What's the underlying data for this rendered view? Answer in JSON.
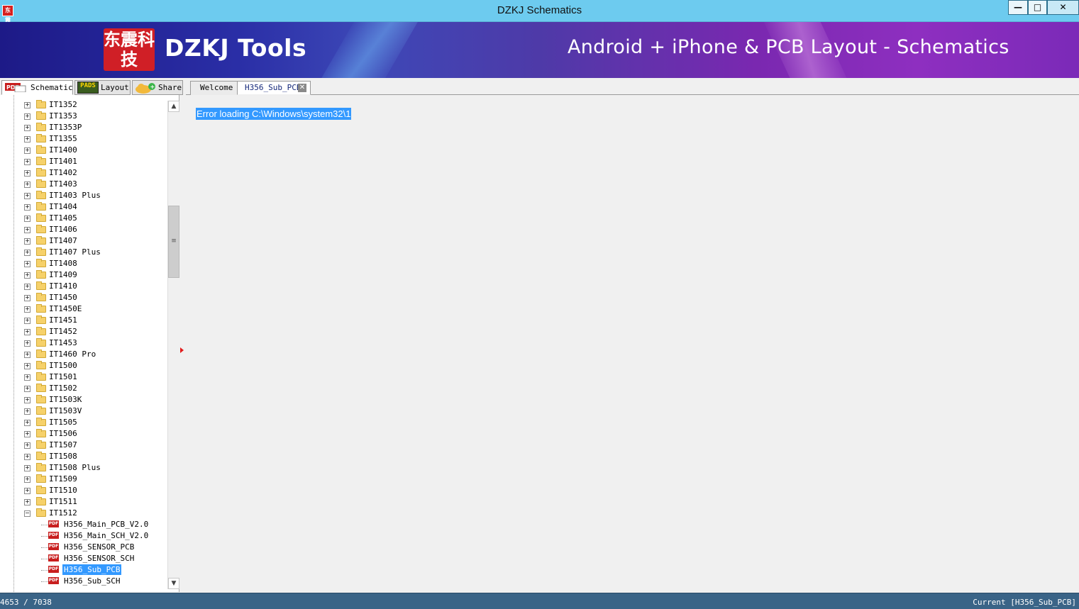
{
  "window": {
    "title": "DZKJ Schematics",
    "app_icon_text": "东震",
    "minimize": "—",
    "maximize": "□",
    "close": "✕"
  },
  "banner": {
    "logo_text": "东震科技",
    "brand": "DZKJ Tools",
    "tagline": "Android + iPhone & PCB Layout - Schematics"
  },
  "left_tabs": [
    {
      "label": "Schematic",
      "icon": "pdf-icon",
      "active": true
    },
    {
      "label": "Layout",
      "icon": "pads-icon",
      "icon_text": "PADS",
      "active": false
    },
    {
      "label": "Share",
      "icon": "cloud-share-icon",
      "active": false
    }
  ],
  "doc_tabs": [
    {
      "label": "Welcome",
      "active": false
    },
    {
      "label": "H356_Sub_PCB",
      "active": true,
      "close": "✕"
    }
  ],
  "tree": {
    "folders": [
      "IT1352",
      "IT1353",
      "IT1353P",
      "IT1355",
      "IT1400",
      "IT1401",
      "IT1402",
      "IT1403",
      "IT1403 Plus",
      "IT1404",
      "IT1405",
      "IT1406",
      "IT1407",
      "IT1407 Plus",
      "IT1408",
      "IT1409",
      "IT1410",
      "IT1450",
      "IT1450E",
      "IT1451",
      "IT1452",
      "IT1453",
      "IT1460 Pro",
      "IT1500",
      "IT1501",
      "IT1502",
      "IT1503K",
      "IT1503V",
      "IT1505",
      "IT1506",
      "IT1507",
      "IT1508",
      "IT1508 Plus",
      "IT1509",
      "IT1510",
      "IT1511",
      "IT1512"
    ],
    "expanded_folder": "IT1512",
    "files": [
      "H356_Main_PCB_V2.0",
      "H356_Main_SCH_V2.0",
      "H356_SENSOR_PCB",
      "H356_SENSOR_SCH",
      "H356_Sub_PCB",
      "H356_Sub_SCH"
    ],
    "selected_file": "H356_Sub_PCB",
    "pdf_icon_text": "PDF",
    "expand_symbol": "+",
    "collapse_symbol": "−"
  },
  "scrollbar": {
    "up": "▲",
    "down": "▼",
    "thumb": "≡"
  },
  "content": {
    "error_message": "Error loading C:\\Windows\\system32\\1"
  },
  "status": {
    "position": "4653 / 7038",
    "current": "Current [H356_Sub_PCB]"
  },
  "colors": {
    "titlebar": "#6dcbef",
    "selection": "#3399ff",
    "statusbar": "#3a6487",
    "logo_red": "#d01f26"
  }
}
